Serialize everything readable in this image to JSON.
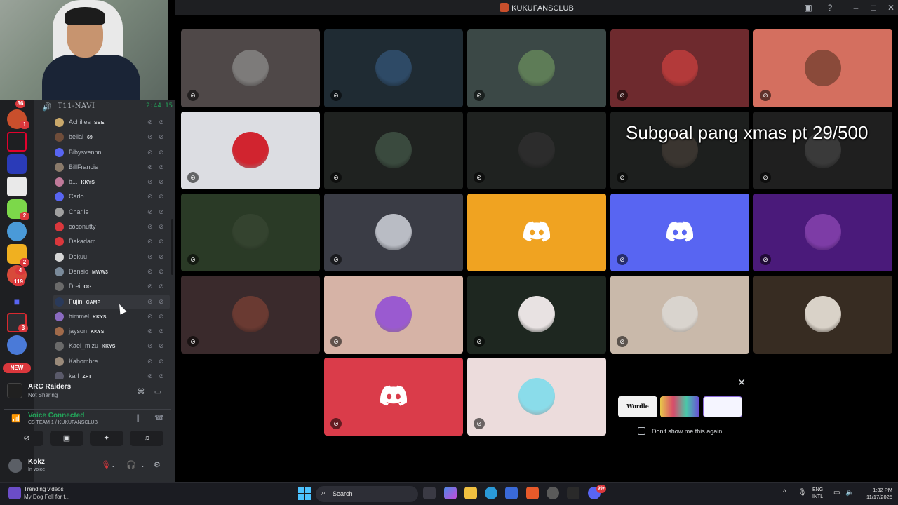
{
  "window": {
    "title": "KUKUFANSCLUB",
    "icons": [
      "inbox-icon",
      "help-icon",
      "minimize-icon",
      "maximize-icon",
      "close-icon"
    ]
  },
  "server_rail": {
    "badges": [
      "36",
      "1",
      "2",
      "2",
      "4",
      "119",
      "3"
    ],
    "new_label": "NEW"
  },
  "channel": {
    "name": "T11-NAVI",
    "timer": "2:44:15",
    "members": [
      {
        "name": "Achilles",
        "tag": "SBE",
        "color": "#c9a86a"
      },
      {
        "name": "belial",
        "tag": "69",
        "color": "#6f4d3a"
      },
      {
        "name": "Bibysvennn",
        "tag": "",
        "color": "#5865f2"
      },
      {
        "name": "BillFrancis",
        "tag": "",
        "color": "#8a7a6a"
      },
      {
        "name": "b...",
        "tag": "KKYS",
        "color": "#c07a9a"
      },
      {
        "name": "Carlo",
        "tag": "",
        "color": "#5865f2"
      },
      {
        "name": "Charlie",
        "tag": "",
        "color": "#a0a0a0"
      },
      {
        "name": "coconutty",
        "tag": "",
        "color": "#da373c"
      },
      {
        "name": "Dakadam",
        "tag": "",
        "color": "#da373c"
      },
      {
        "name": "Dekuu",
        "tag": "",
        "color": "#d6d6d6"
      },
      {
        "name": "Densio",
        "tag": "MWW3",
        "color": "#7a8a9a"
      },
      {
        "name": "Drei",
        "tag": "OG",
        "color": "#6a6a6a"
      },
      {
        "name": "Fujin",
        "tag": "CAMP",
        "color": "#2a3a5a"
      },
      {
        "name": "himmel",
        "tag": "KKYS",
        "color": "#8a6ac0"
      },
      {
        "name": "jayson",
        "tag": "KKYS",
        "color": "#a06a4a"
      },
      {
        "name": "Kael_mizu",
        "tag": "KKYS",
        "color": "#6a6a6a"
      },
      {
        "name": "Kahombre",
        "tag": "",
        "color": "#9a8a7a"
      },
      {
        "name": "karl",
        "tag": "ZFT",
        "color": "#5a5a6a"
      }
    ]
  },
  "activity": {
    "title": "ARC Raiders",
    "subtitle": "Not Sharing"
  },
  "voice": {
    "status": "Voice Connected",
    "location": "CS TEAM 1 / KUKUFANSCLUB"
  },
  "user": {
    "name": "Kokz",
    "status": "In voice"
  },
  "tiles": [
    {
      "bg": "#4f4848",
      "avatar": "#7d7b7a",
      "mic": "deafened",
      "kind": "avatar"
    },
    {
      "bg": "#1f2b33",
      "avatar": "#2e4a66",
      "mic": "deafened",
      "kind": "avatar"
    },
    {
      "bg": "#3b4846",
      "avatar": "#5e7c57",
      "mic": "muted",
      "kind": "avatar"
    },
    {
      "bg": "#6e2a2e",
      "avatar": "#b33a3a",
      "mic": "deafened",
      "kind": "avatar"
    },
    {
      "bg": "#d46f5f",
      "avatar": "#8a4a3a",
      "mic": "deafened",
      "kind": "avatar"
    },
    {
      "bg": "#dcdde2",
      "avatar": "#d1242f",
      "mic": "deafened",
      "kind": "avatar"
    },
    {
      "bg": "#1f2220",
      "avatar": "#3a4a3e",
      "mic": "muted",
      "kind": "avatar"
    },
    {
      "bg": "#1f2220",
      "avatar": "#2c2c2c",
      "mic": "deafened",
      "kind": "avatar"
    },
    {
      "bg": "#1d1f1e",
      "avatar": "#3a3530",
      "mic": "muted",
      "kind": "avatar"
    },
    {
      "bg": "#1f1f1f",
      "avatar": "#3a3a3a",
      "mic": "deafened",
      "kind": "avatar"
    },
    {
      "bg": "#2a3a26",
      "avatar": "#34432f",
      "mic": "deafened",
      "kind": "avatar"
    },
    {
      "bg": "#3a3c45",
      "avatar": "#b9bcc4",
      "mic": "muted",
      "kind": "avatar"
    },
    {
      "bg": "#f0a321",
      "avatar": "",
      "mic": "",
      "kind": "discord"
    },
    {
      "bg": "#5865f2",
      "avatar": "",
      "mic": "muted",
      "kind": "discord"
    },
    {
      "bg": "#4a1a7a",
      "avatar": "#7d3ca6",
      "mic": "muted",
      "kind": "avatar"
    },
    {
      "bg": "#3a2a2c",
      "avatar": "#6a3a32",
      "mic": "muted",
      "kind": "avatar"
    },
    {
      "bg": "#d6b3a6",
      "avatar": "#9a5ad0",
      "mic": "muted",
      "kind": "avatar"
    },
    {
      "bg": "#1e2720",
      "avatar": "#e8e2e2",
      "mic": "muted",
      "kind": "avatar"
    },
    {
      "bg": "#c9b9aa",
      "avatar": "#d9d4ce",
      "mic": "muted",
      "kind": "avatar"
    },
    {
      "bg": "#372c22",
      "avatar": "#d9d2c8",
      "mic": "",
      "kind": "avatar"
    },
    {
      "bg": "#da3c4a",
      "avatar": "",
      "mic": "muted",
      "kind": "discord"
    },
    {
      "bg": "#ecdcdc",
      "avatar": "#8adcea",
      "mic": "deafened",
      "kind": "avatar"
    }
  ],
  "overlay": {
    "text": "Subgoal pang xmas pt  29/500"
  },
  "suggestion": {
    "cards": [
      "Wordle",
      "",
      ""
    ],
    "checkbox_label": "Don't show me this again."
  },
  "taskbar": {
    "weather_title": "Trending videos",
    "weather_sub": "My Dog Fell for t...",
    "search_placeholder": "Search",
    "lang_line1": "ENG",
    "lang_line2": "INTL",
    "time": "1:32 PM",
    "date": "11/17/2025",
    "discord_badge": "99+"
  }
}
